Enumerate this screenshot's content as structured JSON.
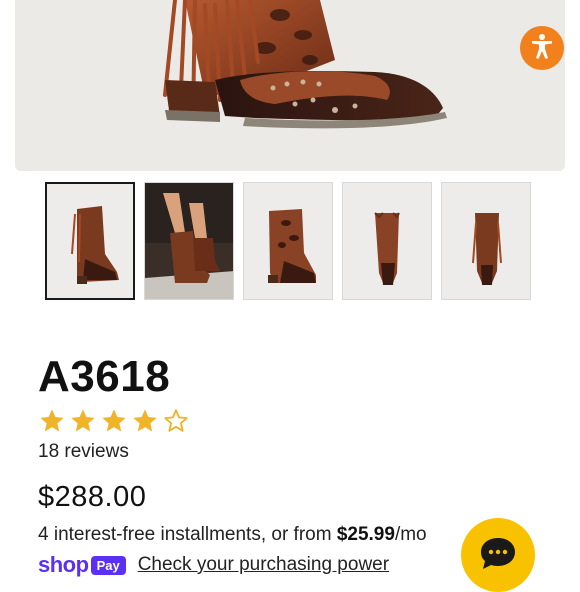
{
  "product": {
    "title": "A3618",
    "rating": 4,
    "rating_max": 5,
    "reviews_label": "18 reviews",
    "price": "$288.00"
  },
  "installments": {
    "prefix": "4 interest-free installments, or from ",
    "amount": "$25.99",
    "suffix": "/mo "
  },
  "shop_pay": {
    "brand_shop": "shop",
    "brand_pay": "Pay",
    "link_label": "Check your purchasing power"
  },
  "gallery": {
    "selected_index": 0,
    "thumbnail_count": 5
  },
  "icons": {
    "accessibility": "accessibility-icon",
    "chat": "chat-bubble-icon",
    "star_filled": "star-filled-icon",
    "star_empty": "star-outline-icon"
  },
  "colors": {
    "star": "#f0b428",
    "shop_pay": "#5a31f4",
    "accessibility_button": "#f2811d",
    "chat_button": "#f8c200"
  }
}
